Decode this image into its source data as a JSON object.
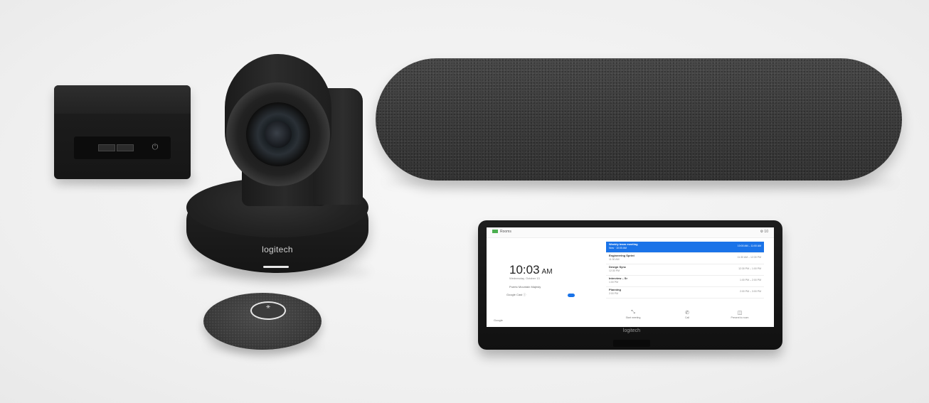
{
  "camera": {
    "logo": "logitech"
  },
  "mic": {
    "button_glyph": "⚹"
  },
  "compute": {
    "power_glyph": "⏻"
  },
  "tablet": {
    "chin_logo": "logitech",
    "screen": {
      "brand": "Rooms",
      "topbar_icons": "⚙ 10",
      "time": "10:03",
      "ampm": "AM",
      "date": "Wednesday, October 13",
      "room_name": "Puerto Mountain Majesty",
      "cast_label": "Google Cast ⓘ",
      "meetings": [
        {
          "title": "Weekly team meeting",
          "subtitle": "Now · 10:00 AM",
          "time": "10:00 AM – 11:00 AM"
        },
        {
          "title": "Engineering Sprint",
          "subtitle": "11:30 AM",
          "time": "11:30 AM – 12:30 PM"
        },
        {
          "title": "Design Sync",
          "subtitle": "12:30 PM",
          "time": "12:30 PM – 1:00 PM"
        },
        {
          "title": "Interview – Sr",
          "subtitle": "1:00 PM",
          "time": "1:00 PM – 2:00 PM"
        },
        {
          "title": "Planning",
          "subtitle": "2:00 PM",
          "time": "2:00 PM – 3:00 PM"
        }
      ],
      "footer_brand": "Google",
      "actions": [
        {
          "icon": "⤡",
          "label": "Start meeting"
        },
        {
          "icon": "✆",
          "label": "Call"
        },
        {
          "icon": "◫",
          "label": "Present to room"
        }
      ]
    }
  }
}
